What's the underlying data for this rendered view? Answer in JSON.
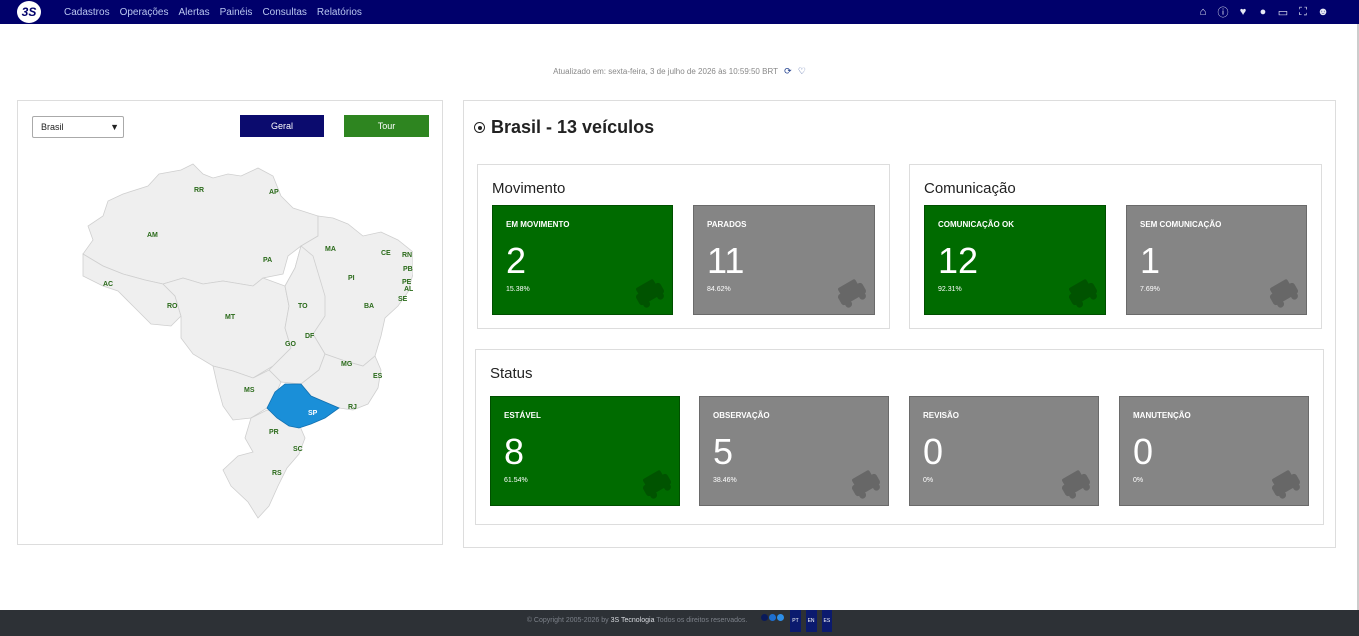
{
  "nav": {
    "logo": "3S",
    "items": [
      "Cadastros",
      "Operações",
      "Alertas",
      "Painéis",
      "Consultas",
      "Relatórios"
    ],
    "icons": [
      "home-icon",
      "info-icon",
      "heart-icon",
      "chat-icon",
      "laptop-icon",
      "fullscreen-icon",
      "user-icon"
    ]
  },
  "updated_text": "Atualizado em: sexta-feira, 3 de julho de 2026 às 10:59:50 BRT",
  "map_panel": {
    "select_value": "Brasil",
    "btn_geral": "Geral",
    "btn_tour": "Tour",
    "states": [
      "RR",
      "AP",
      "AM",
      "MA",
      "CE",
      "RN",
      "PA",
      "PB",
      "PE",
      "PI",
      "AL",
      "SE",
      "AC",
      "RO",
      "TO",
      "BA",
      "MT",
      "DF",
      "GO",
      "MG",
      "ES",
      "MS",
      "SP",
      "RJ",
      "PR",
      "SC",
      "RS"
    ],
    "highlight_state": "SP",
    "highlight_color": "#1a8fd8"
  },
  "dashboard": {
    "title": "Brasil - 13 veículos",
    "movimento": {
      "title": "Movimento",
      "cards": [
        {
          "label": "EM MOVIMENTO",
          "value": "2",
          "pct": "15.38%"
        },
        {
          "label": "PARADOS",
          "value": "11",
          "pct": "84.62%"
        }
      ]
    },
    "comunicacao": {
      "title": "Comunicação",
      "cards": [
        {
          "label": "COMUNICAÇÃO OK",
          "value": "12",
          "pct": "92.31%"
        },
        {
          "label": "SEM COMUNICAÇÃO",
          "value": "1",
          "pct": "7.69%"
        }
      ]
    },
    "status": {
      "title": "Status",
      "cards": [
        {
          "label": "ESTÁVEL",
          "value": "8",
          "pct": "61.54%"
        },
        {
          "label": "OBSERVAÇÃO",
          "value": "5",
          "pct": "38.46%"
        },
        {
          "label": "REVISÃO",
          "value": "0",
          "pct": "0%"
        },
        {
          "label": "MANUTENÇÃO",
          "value": "0",
          "pct": "0%"
        }
      ]
    }
  },
  "colors": {
    "navbar": "#00006b",
    "green": "#006b00",
    "gray": "#858585",
    "tour": "#2e8520"
  },
  "footer": {
    "prefix": "© Copyright 2005-2026 by",
    "company": "3S Tecnologia",
    "suffix": "Todos os direitos reservados.",
    "langs": [
      "PT",
      "EN",
      "ES"
    ]
  }
}
